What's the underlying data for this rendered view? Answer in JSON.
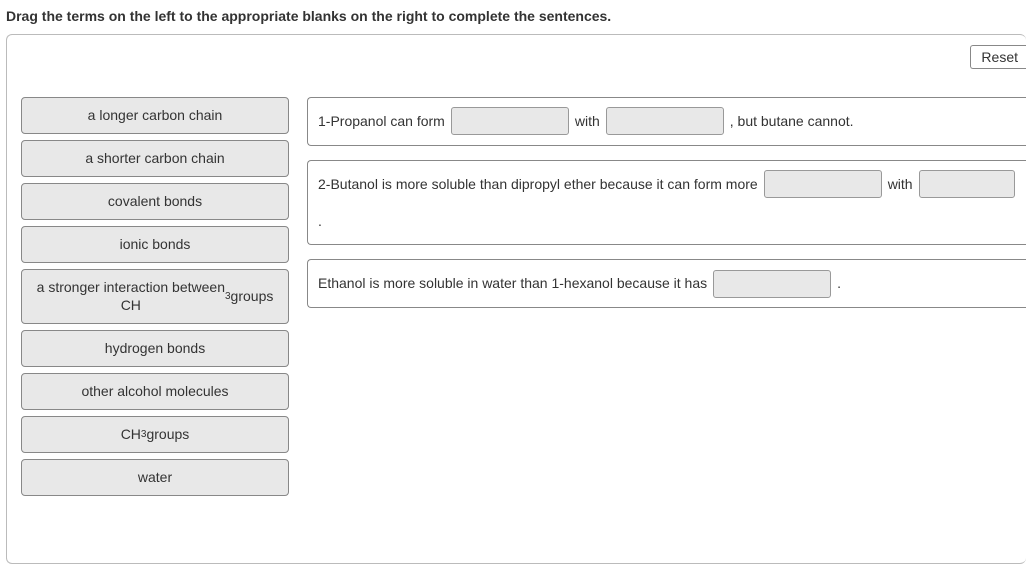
{
  "instruction": "Drag the terms on the left to the appropriate blanks on the right to complete the sentences.",
  "reset_label": "Reset",
  "terms": [
    {
      "label": "a longer carbon chain",
      "html": false
    },
    {
      "label": "a shorter carbon chain",
      "html": false
    },
    {
      "label": "covalent bonds",
      "html": false
    },
    {
      "label": "ionic bonds",
      "html": false
    },
    {
      "label": "a stronger interaction between CH3 groups",
      "html": true,
      "render": "a stronger interaction between<br>CH<span class=\"sub\">3</span> groups"
    },
    {
      "label": "hydrogen bonds",
      "html": false
    },
    {
      "label": "other alcohol molecules",
      "html": false
    },
    {
      "label": "CH3 groups",
      "html": true,
      "render": "CH<span class=\"sub\">3</span> groups"
    },
    {
      "label": "water",
      "html": false
    }
  ],
  "sentences": {
    "s1": {
      "p1": "1-Propanol can form",
      "p2": "with",
      "p3": ", but butane cannot."
    },
    "s2": {
      "p1": "2-Butanol is more soluble than dipropyl ether because it can form more",
      "p2": "with",
      "p3": "."
    },
    "s3": {
      "p1": "Ethanol is more soluble in water than 1-hexanol because it has",
      "p2": "."
    }
  }
}
